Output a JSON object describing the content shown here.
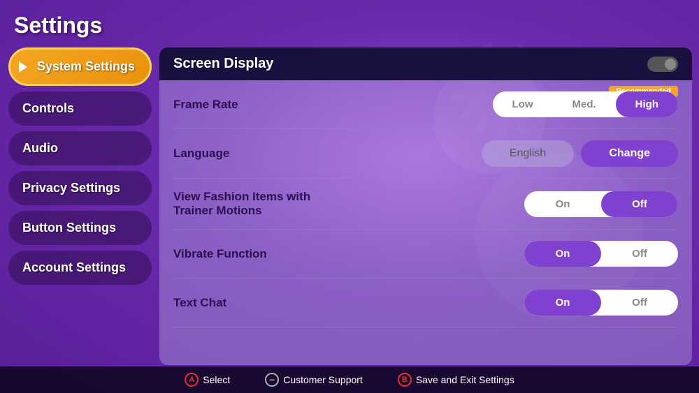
{
  "page": {
    "title": "Settings"
  },
  "sidebar": {
    "items": [
      {
        "id": "system-settings",
        "label": "System Settings",
        "active": true
      },
      {
        "id": "controls",
        "label": "Controls",
        "active": false
      },
      {
        "id": "audio",
        "label": "Audio",
        "active": false
      },
      {
        "id": "privacy-settings",
        "label": "Privacy Settings",
        "active": false
      },
      {
        "id": "button-settings",
        "label": "Button Settings",
        "active": false
      },
      {
        "id": "account-settings",
        "label": "Account Settings",
        "active": false
      }
    ]
  },
  "main": {
    "section_title": "Screen Display",
    "settings": [
      {
        "id": "frame-rate",
        "label": "Frame Rate",
        "type": "three-option",
        "options": [
          "Low",
          "Med.",
          "High"
        ],
        "selected": "High",
        "badge": "Recommended"
      },
      {
        "id": "language",
        "label": "Language",
        "type": "language",
        "value": "English",
        "button": "Change"
      },
      {
        "id": "fashion-items",
        "label": "View Fashion Items with Trainer Motions",
        "type": "two-option",
        "options": [
          "On",
          "Off"
        ],
        "selected": "Off"
      },
      {
        "id": "vibrate-function",
        "label": "Vibrate Function",
        "type": "two-option",
        "options": [
          "On",
          "Off"
        ],
        "selected": "On"
      },
      {
        "id": "text-chat",
        "label": "Text Chat",
        "type": "two-option",
        "options": [
          "On",
          "Off"
        ],
        "selected": "On"
      }
    ]
  },
  "bottom_bar": {
    "actions": [
      {
        "id": "select",
        "icon": "A",
        "label": "Select"
      },
      {
        "id": "customer-support",
        "icon": "−",
        "label": "Customer Support"
      },
      {
        "id": "save-exit",
        "icon": "B",
        "label": "Save and Exit Settings"
      }
    ]
  },
  "colors": {
    "accent_purple": "#8040d0",
    "accent_orange": "#f5a623",
    "selected_btn": "#8040d0",
    "bg_dark": "#1a1040"
  }
}
